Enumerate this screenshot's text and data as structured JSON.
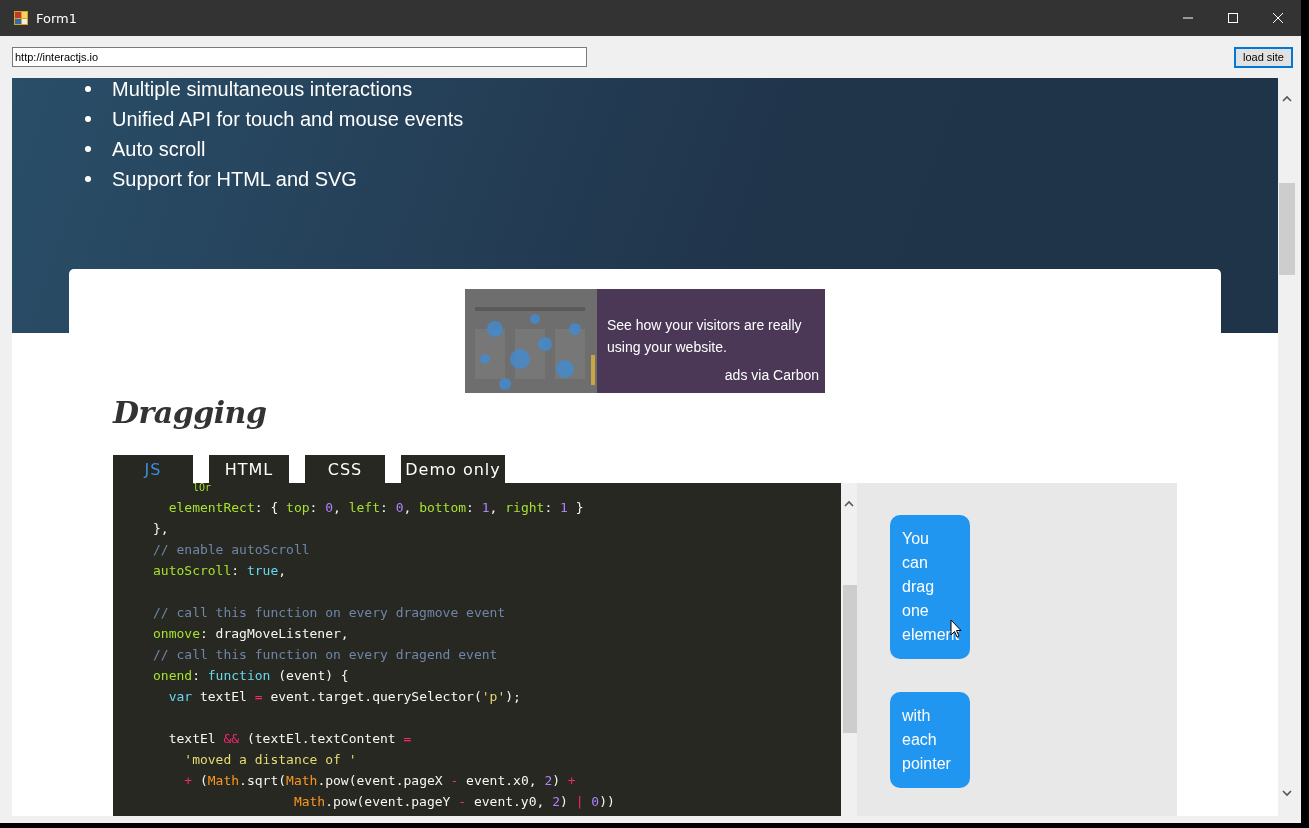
{
  "window": {
    "title": "Form1"
  },
  "address_bar": {
    "value": "http://interactjs.io"
  },
  "load_button": {
    "label": "load site"
  },
  "features": [
    "Multiple simultaneous interactions",
    "Unified API for touch and mouse events",
    "Auto scroll",
    "Support for HTML and SVG"
  ],
  "ad": {
    "text": "See how your visitors are really using your website.",
    "attribution": "ads via Carbon"
  },
  "section": {
    "title": "Dragging",
    "tabs": [
      {
        "label": "JS",
        "selected": true
      },
      {
        "label": "HTML",
        "selected": false
      },
      {
        "label": "CSS",
        "selected": false
      },
      {
        "label": "Demo only",
        "selected": false
      }
    ],
    "code": {
      "clipped_text": "lOr",
      "lines": [
        {
          "kind": "code",
          "tokens": [
            {
              "kind": "key",
              "text": "  elementRect"
            },
            {
              "kind": "p",
              "text": ": { "
            },
            {
              "kind": "key",
              "text": "top"
            },
            {
              "kind": "p",
              "text": ": "
            },
            {
              "kind": "num",
              "text": "0"
            },
            {
              "kind": "p",
              "text": ", "
            },
            {
              "kind": "key",
              "text": "left"
            },
            {
              "kind": "p",
              "text": ": "
            },
            {
              "kind": "num",
              "text": "0"
            },
            {
              "kind": "p",
              "text": ", "
            },
            {
              "kind": "key",
              "text": "bottom"
            },
            {
              "kind": "p",
              "text": ": "
            },
            {
              "kind": "num",
              "text": "1"
            },
            {
              "kind": "p",
              "text": ", "
            },
            {
              "kind": "key",
              "text": "right"
            },
            {
              "kind": "p",
              "text": ": "
            },
            {
              "kind": "num",
              "text": "1"
            },
            {
              "kind": "p",
              "text": " }"
            }
          ]
        },
        {
          "kind": "code",
          "tokens": [
            {
              "kind": "p",
              "text": "},"
            }
          ]
        },
        {
          "kind": "code",
          "tokens": [
            {
              "kind": "comment",
              "text": "// enable autoScroll"
            }
          ]
        },
        {
          "kind": "code",
          "tokens": [
            {
              "kind": "key",
              "text": "autoScroll"
            },
            {
              "kind": "p",
              "text": ": "
            },
            {
              "kind": "kw",
              "text": "true"
            },
            {
              "kind": "p",
              "text": ","
            }
          ]
        },
        {
          "kind": "blank"
        },
        {
          "kind": "code",
          "tokens": [
            {
              "kind": "comment",
              "text": "// call this function on every dragmove event"
            }
          ]
        },
        {
          "kind": "code",
          "tokens": [
            {
              "kind": "key",
              "text": "onmove"
            },
            {
              "kind": "p",
              "text": ": dragMoveListener,"
            }
          ]
        },
        {
          "kind": "code",
          "tokens": [
            {
              "kind": "comment",
              "text": "// call this function on every dragend event"
            }
          ]
        },
        {
          "kind": "code",
          "tokens": [
            {
              "kind": "key",
              "text": "onend"
            },
            {
              "kind": "p",
              "text": ": "
            },
            {
              "kind": "kw",
              "text": "function"
            },
            {
              "kind": "p",
              "text": " (event) {"
            }
          ]
        },
        {
          "kind": "code",
          "tokens": [
            {
              "kind": "kw",
              "text": "  var"
            },
            {
              "kind": "p",
              "text": " textEl "
            },
            {
              "kind": "op",
              "text": "="
            },
            {
              "kind": "p",
              "text": " event.target.querySelector("
            },
            {
              "kind": "str",
              "text": "'p'"
            },
            {
              "kind": "p",
              "text": ");"
            }
          ]
        },
        {
          "kind": "blank"
        },
        {
          "kind": "code",
          "tokens": [
            {
              "kind": "p",
              "text": "  textEl "
            },
            {
              "kind": "op",
              "text": "&&"
            },
            {
              "kind": "p",
              "text": " (textEl.textContent "
            },
            {
              "kind": "op",
              "text": "="
            }
          ]
        },
        {
          "kind": "code",
          "tokens": [
            {
              "kind": "str",
              "text": "    'moved a distance of '"
            }
          ]
        },
        {
          "kind": "code",
          "tokens": [
            {
              "kind": "op",
              "text": "    +"
            },
            {
              "kind": "p",
              "text": " ("
            },
            {
              "kind": "fn",
              "text": "Math"
            },
            {
              "kind": "p",
              "text": ".sqrt("
            },
            {
              "kind": "fn",
              "text": "Math"
            },
            {
              "kind": "p",
              "text": ".pow(event.pageX "
            },
            {
              "kind": "op",
              "text": "-"
            },
            {
              "kind": "p",
              "text": " event.x0, "
            },
            {
              "kind": "num",
              "text": "2"
            },
            {
              "kind": "p",
              "text": ") "
            },
            {
              "kind": "op",
              "text": "+"
            }
          ]
        },
        {
          "kind": "code",
          "tokens": [
            {
              "kind": "fn",
              "text": "                  Math"
            },
            {
              "kind": "p",
              "text": ".pow(event.pageY "
            },
            {
              "kind": "op",
              "text": "-"
            },
            {
              "kind": "p",
              "text": " event.y0, "
            },
            {
              "kind": "num",
              "text": "2"
            },
            {
              "kind": "p",
              "text": ") "
            },
            {
              "kind": "op",
              "text": "| "
            },
            {
              "kind": "num",
              "text": "0"
            },
            {
              "kind": "p",
              "text": "))"
            }
          ]
        }
      ]
    },
    "demo": {
      "boxes": [
        "You can drag one element",
        "with each pointer"
      ]
    }
  }
}
